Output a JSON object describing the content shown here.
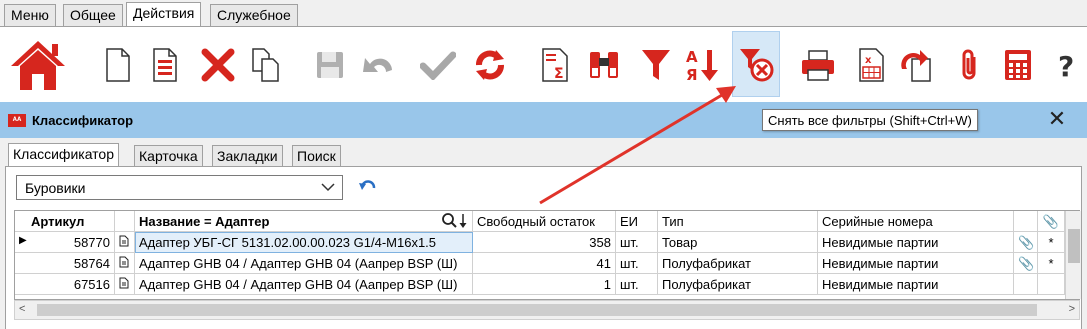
{
  "menu_tabs": [
    "Меню",
    "Общее",
    "Действия",
    "Служебное"
  ],
  "toolbar": {
    "tooltip": "Снять все фильтры (Shift+Ctrl+W)",
    "buttons": [
      "home-icon",
      "new-document-icon",
      "document-list-icon",
      "delete-icon",
      "copy-icon",
      "save-icon",
      "undo-icon",
      "check-icon",
      "refresh-icon",
      "sum-icon",
      "binoculars-icon",
      "filter-icon",
      "sort-az-icon",
      "clear-filter-icon",
      "printer-icon",
      "excel-icon",
      "export-icon",
      "attachment-icon",
      "calculator-icon",
      "help-icon"
    ]
  },
  "window": {
    "title": "Классификатор",
    "logo_text": "ᴬᴬ"
  },
  "inner_tabs": [
    "Классификатор",
    "Карточка",
    "Закладки",
    "Поиск"
  ],
  "filter_combo": {
    "value": "Буровики"
  },
  "table": {
    "headers": {
      "article": "Артикул",
      "name": "Название  = Адаптер",
      "stock": "Свободный остаток",
      "unit": "ЕИ",
      "type": "Тип",
      "serial": "Серийные номера"
    },
    "rows": [
      {
        "marker": "▶",
        "article": "58770",
        "name": "Адаптер  УБГ-СГ 5131.02.00.00.023  G1/4-M16x1.5",
        "stock": "358",
        "unit": "шт.",
        "type": "Товар",
        "serial": "Невидимые партии",
        "clip": true,
        "star": "*"
      },
      {
        "marker": "",
        "article": "58764",
        "name": "Адаптер GHB 04 / Адаптер GHB 04 (Аапрер BSP (Ш)",
        "stock": "41",
        "unit": "шт.",
        "type": "Полуфабрикат",
        "serial": "Невидимые партии",
        "clip": true,
        "star": "*"
      },
      {
        "marker": "",
        "article": "67516",
        "name": "Адаптер GHB 04 / Адаптер GHB 04 (Аапрер BSP (Ш)",
        "stock": "1",
        "unit": "шт.",
        "type": "Полуфабрикат",
        "serial": "Невидимые партии",
        "clip": false,
        "star": ""
      }
    ]
  },
  "colors": {
    "accent_red": "#d6261e",
    "title_bar": "#99c6ea",
    "icon_gray": "#a0a0a0",
    "annotation_arrow": "#e0332a"
  }
}
